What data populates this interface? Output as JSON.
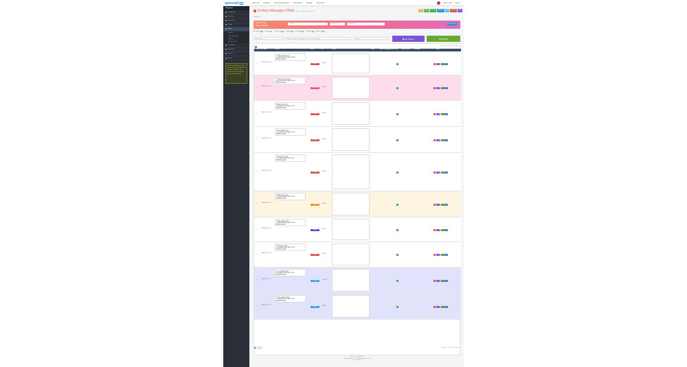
{
  "brand": {
    "logo": "opencart"
  },
  "topnav": [
    "Store Info",
    "Analytics",
    "Order Manager PRO",
    "Marketplace",
    "Manage",
    "Extensions"
  ],
  "topright": {
    "user": "Admin User",
    "logout": "Logout"
  },
  "sidebar": {
    "title": "Navigation",
    "items": [
      "Dashboard",
      "Catalog",
      "Extensions",
      "Design",
      "Sales",
      "Customers",
      "Marketing",
      "System",
      "Reports"
    ],
    "subs": [
      "Orders",
      "Order Manager",
      "Returns",
      "Gift Vouchers"
    ],
    "promo": "Get the Order Manager PRO extension and track all orders, statuses, customers and revenue on one screen with filters and quick actions."
  },
  "header": {
    "title": "Orders Manager PRO",
    "crumb": "Home › Orders › Orders Manager PRO",
    "buttons": [
      "Filter",
      "Export",
      "Invoice",
      "Shipping",
      "Print",
      "Settings",
      "Help"
    ]
  },
  "list_label": "Order List",
  "filter": {
    "title": "Personalised Orders Widget",
    "customer_placeholder": "Customer",
    "status_placeholder": "All Statuses",
    "date_placeholder": "Date Added",
    "button": "Filter Orders"
  },
  "tabs": [
    {
      "label": "All Orders",
      "count": "10"
    },
    {
      "label": "Pending",
      "count": "3"
    },
    {
      "label": "Processing",
      "count": "2"
    },
    {
      "label": "Shipped",
      "count": "1"
    },
    {
      "label": "Complete",
      "count": "2"
    },
    {
      "label": "Canceled",
      "count": "1"
    },
    {
      "label": "Refunded",
      "count": "1"
    }
  ],
  "chips": {
    "a": "Order Status",
    "b": "Select Order ID / Customer / Email / Phone / Product",
    "c": "All Stores"
  },
  "summary": {
    "orders": "10 Orders",
    "revenue": "$3,650.00"
  },
  "totals": "Showing 1 to 10 of 10 (1 Pages)",
  "columns": [
    "Order ID",
    "Date Added",
    "Customer",
    "Status",
    "Total",
    "Products",
    "Invoice",
    "Payment Method",
    "Shipping Method",
    "Notify",
    "Tracking Number",
    "Date Modified",
    "Action"
  ],
  "orders": [
    {
      "id": "10",
      "date": "23/08/2023 15:04:05",
      "status": "Pending",
      "color": "#e05050",
      "total": "$125.00",
      "name": "John Doe (1)",
      "email": "john@example.com",
      "phone": "555-0101"
    },
    {
      "id": "9",
      "date": "22/08/2023 13:12:01",
      "status": "Processing",
      "color": "#e84ca0",
      "total": "$205.00",
      "name": "Jane Smith (2)",
      "email": "jane@example.com",
      "phone": "555-0102"
    },
    {
      "id": "8",
      "date": "21/08/2023 11:40:22",
      "status": "Pending",
      "color": "#e05050",
      "total": "$85.00",
      "name": "Bob Lee (3)",
      "email": "bob@example.com",
      "phone": "555-0103"
    },
    {
      "id": "7",
      "date": "20/08/2023 10:05:47",
      "status": "Pending",
      "color": "#e05050",
      "total": "$410.00",
      "name": "Ann Roe (4)",
      "email": "ann@example.com",
      "phone": "555-0104"
    },
    {
      "id": "6",
      "date": "19/08/2023 09:33:18",
      "status": "Pending",
      "color": "#e05050",
      "total": "$160.00",
      "name": "Tim Fox (5)",
      "email": "tim@example.com",
      "phone": "555-0105"
    },
    {
      "id": "5",
      "date": "18/08/2023 16:21:09",
      "status": "Shipped",
      "color": "#ef8f1e",
      "total": "$320.00",
      "name": "Mia Kay (6)",
      "email": "mia@example.com",
      "phone": "555-0106"
    },
    {
      "id": "4",
      "date": "17/08/2023 14:55:30",
      "status": "Complete",
      "color": "#4b52d8",
      "total": "$95.00",
      "name": "Sam Ray (7)",
      "email": "sam@example.com",
      "phone": "555-0107"
    },
    {
      "id": "3",
      "date": "16/08/2023 12:10:44",
      "status": "Canceled",
      "color": "#e05050",
      "total": "$560.00",
      "name": "Eva Lin (8)",
      "email": "eva@example.com",
      "phone": "555-0108"
    },
    {
      "id": "2",
      "date": "15/08/2023 08:45:12",
      "status": "Complete",
      "color": "#2fa7dc",
      "total": "$1,240.00",
      "name": "Leo Park (9)",
      "email": "leo@example.com",
      "phone": "555-0109"
    },
    {
      "id": "1",
      "date": "14/08/2023 07:30:59",
      "status": "Refunded",
      "color": "#2fa7dc",
      "total": "$450.00",
      "name": "Zoe Hart (10)",
      "email": "zoe@example.com",
      "phone": "555-0110"
    }
  ],
  "pagination": "Showing 1 to 10 of 10 (1 Pages)",
  "footer": [
    "OpenCart Version 3.0.3.8",
    "Order Manager PRO © 2023 All Rights Reserved",
    "Version 3.0.3.8"
  ]
}
